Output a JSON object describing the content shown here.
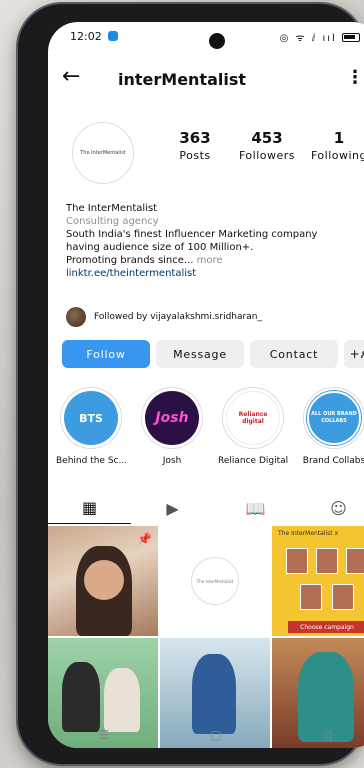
{
  "status": {
    "time": "12:02",
    "icons": "◎ ᯤ ⅈ ııl"
  },
  "header": {
    "username": "interMentalist",
    "back_icon": "arrow-left-icon",
    "more_icon": "kebab-icon"
  },
  "profile": {
    "avatar_text": "The InterMentalist",
    "stats": [
      {
        "num": "363",
        "label": "Posts"
      },
      {
        "num": "453",
        "label": "Followers"
      },
      {
        "num": "1",
        "label": "Following"
      }
    ],
    "name": "The InterMentalist",
    "category": "Consulting agency",
    "bio_line1": "South India's finest Influencer Marketing company",
    "bio_line2": "having audience size of 100 Million+.",
    "bio_line3": "Promoting brands since...",
    "more": "more",
    "link": "linktr.ee/theintermentalist",
    "followed_by": "Followed by vijayalakshmi.sridharan_"
  },
  "buttons": {
    "follow": "Follow",
    "message": "Message",
    "contact": "Contact",
    "add_person": "+ዖ"
  },
  "highlights": [
    {
      "label": "Behind the Sc...",
      "cover": "BTS"
    },
    {
      "label": "Josh",
      "cover": "Josh"
    },
    {
      "label": "Reliance Digital",
      "cover": "Reliance digital"
    },
    {
      "label": "Brand Collabs",
      "cover": "ALL OUR BRAND COLLABS"
    }
  ],
  "tabs": [
    "grid-icon",
    "reels-icon",
    "guides-icon",
    "tagged-icon"
  ],
  "grid": {
    "c2_text": "The InterMentalist",
    "c3_title": "The InterMentalist x",
    "c3_cta": "Choose campaign"
  },
  "colors": {
    "accent": "#3797f0",
    "link": "#00376b",
    "muted": "#8e8e8e"
  }
}
